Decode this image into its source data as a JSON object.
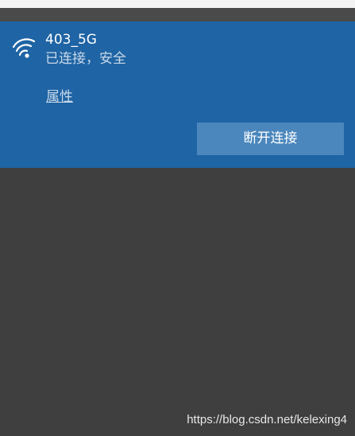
{
  "network": {
    "name": "403_5G",
    "status": "已连接，安全",
    "properties_label": "属性",
    "disconnect_label": "断开连接",
    "icon": "wifi-icon"
  },
  "watermark": "https://blog.csdn.net/kelexing4",
  "colors": {
    "card_background": "#1f64a4",
    "button_background": "#4b87bd",
    "panel_background": "#3f3f3f"
  }
}
